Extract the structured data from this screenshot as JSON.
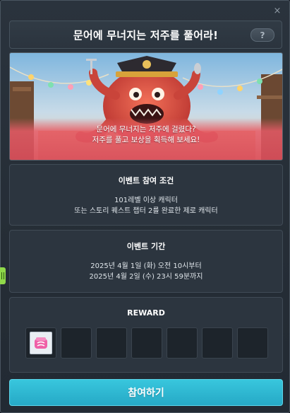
{
  "window": {
    "close_glyph": "×"
  },
  "title": {
    "text": "문어에 무너지는 저주를 풀어라!",
    "help_label": "?"
  },
  "banner": {
    "caption_line1": "문어에 무너지는 저주에 걸렸다?",
    "caption_line2": "저주를 풀고 보상을 획득해 보세요!"
  },
  "condition": {
    "title": "이벤트 참여 조건",
    "line1": "101레벨 이상 캐릭터",
    "line2": "또는 스토리 퀘스트 챕터 2를 완료한 제로 캐릭터"
  },
  "period": {
    "title": "이벤트 기간",
    "line1": "2025년 4월 1일 (화) 오전 10시부터",
    "line2": "2025년 4월 2일 (수) 23시 59분까지"
  },
  "reward": {
    "title": "REWARD",
    "slots": [
      {
        "filled": true,
        "icon": "pink-box-item-icon"
      },
      {
        "filled": false
      },
      {
        "filled": false
      },
      {
        "filled": false
      },
      {
        "filled": false
      },
      {
        "filled": false
      },
      {
        "filled": false
      }
    ]
  },
  "join_button": {
    "label": "참여하기"
  },
  "colors": {
    "accent": "#2bb6d2",
    "panel": "#2c353f",
    "side_tab": "#8fd84a"
  }
}
